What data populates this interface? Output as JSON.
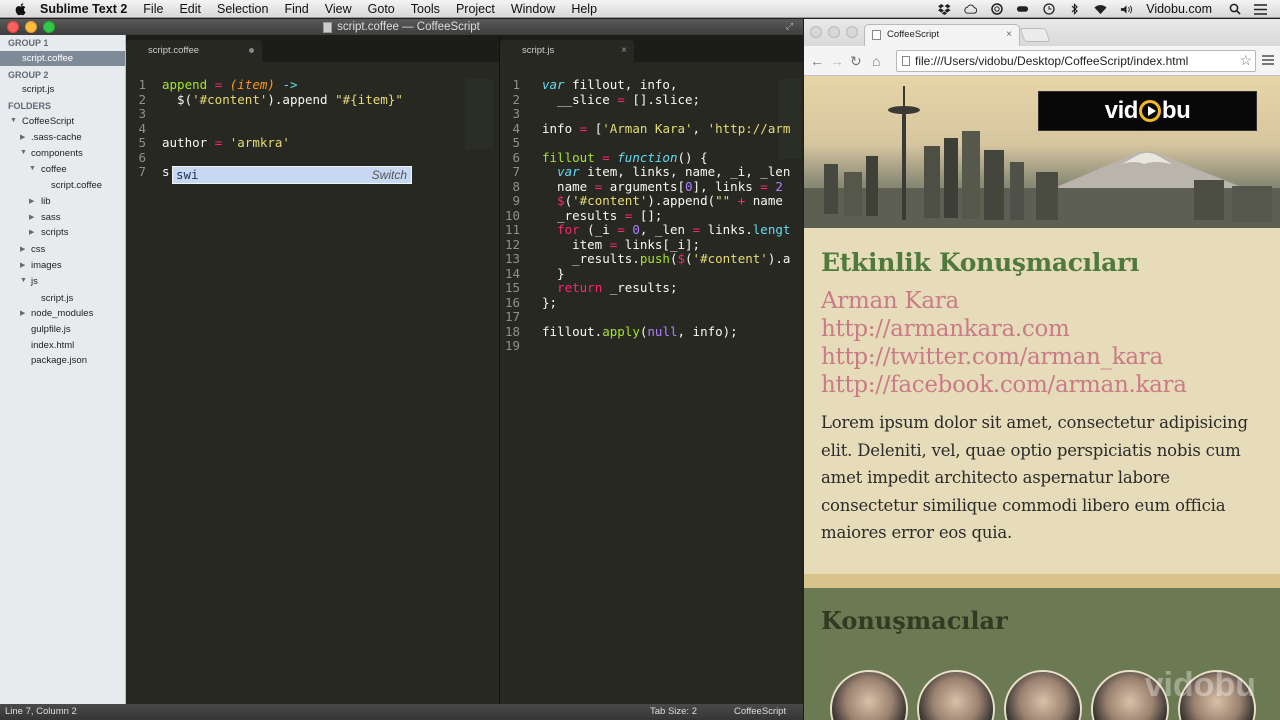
{
  "menubar": {
    "app_name": "Sublime Text 2",
    "menus": [
      "File",
      "Edit",
      "Selection",
      "Find",
      "View",
      "Goto",
      "Tools",
      "Project",
      "Window",
      "Help"
    ],
    "user": "Vidobu.com"
  },
  "sublime": {
    "window_title": "script.coffee — CoffeeScript",
    "sidebar": {
      "group1_label": "GROUP 1",
      "group1_file": "script.coffee",
      "group2_label": "GROUP 2",
      "group2_file": "script.js",
      "folders_label": "FOLDERS",
      "tree": [
        "CoffeeScript",
        ".sass-cache",
        "components",
        "coffee",
        "script.coffee",
        "lib",
        "sass",
        "scripts",
        "css",
        "images",
        "js",
        "script.js",
        "node_modules",
        "gulpfile.js",
        "index.html",
        "package.json"
      ]
    },
    "left_tab": "script.coffee",
    "right_tab": "script.js",
    "autocomplete": {
      "typed": "swi",
      "match": "Switch"
    },
    "status": {
      "position": "Line 7, Column 2",
      "tab_size": "Tab Size: 2",
      "syntax": "CoffeeScript"
    }
  },
  "browser": {
    "tab_title": "CoffeeScript",
    "url": "file:///Users/vidobu/Desktop/CoffeeScript/index.html",
    "logo_text_left": "vid",
    "logo_text_right": "bu",
    "heading": "Etkinlik Konuşmacıları",
    "speaker_name": "Arman Kara",
    "speaker_links": [
      "http://armankara.com",
      "http://twitter.com/arman_kara",
      "http://facebook.com/arman.kara"
    ],
    "lorem": "Lorem ipsum dolor sit amet, consectetur adipisicing elit. Deleniti, vel, quae optio perspiciatis nobis cum amet impedit architecto aspernatur labore consectetur similique commodi libero eum officia maiores error eos quia.",
    "section2_heading": "Konuşmacılar",
    "watermark": "vidobu"
  },
  "code_left": [
    {
      "n": "1",
      "t": "append = (item) ->"
    },
    {
      "n": "2",
      "t": "  $('#content').append \"#{item}\""
    },
    {
      "n": "3",
      "t": ""
    },
    {
      "n": "4",
      "t": ""
    },
    {
      "n": "5",
      "t": "author = 'armkra'"
    },
    {
      "n": "6",
      "t": ""
    },
    {
      "n": "7",
      "t": "s"
    }
  ],
  "code_right": [
    {
      "n": "1",
      "t": "var fillout, info,"
    },
    {
      "n": "2",
      "t": "  __slice = [].slice;"
    },
    {
      "n": "3",
      "t": ""
    },
    {
      "n": "4",
      "t": "info = ['Arman Kara', 'http://arm"
    },
    {
      "n": "5",
      "t": ""
    },
    {
      "n": "6",
      "t": "fillout = function() {"
    },
    {
      "n": "7",
      "t": "  var item, links, name, _i, _len"
    },
    {
      "n": "8",
      "t": "  name = arguments[0], links = 2"
    },
    {
      "n": "9",
      "t": "  $('#content').append(\"\" + name"
    },
    {
      "n": "10",
      "t": "  _results = [];"
    },
    {
      "n": "11",
      "t": "  for (_i = 0, _len = links.lengt"
    },
    {
      "n": "12",
      "t": "    item = links[_i];"
    },
    {
      "n": "13",
      "t": "    _results.push($('#content').a"
    },
    {
      "n": "14",
      "t": "  }"
    },
    {
      "n": "15",
      "t": "  return _results;"
    },
    {
      "n": "16",
      "t": "};"
    },
    {
      "n": "17",
      "t": ""
    },
    {
      "n": "18",
      "t": "fillout.apply(null, info);"
    },
    {
      "n": "19",
      "t": ""
    }
  ]
}
